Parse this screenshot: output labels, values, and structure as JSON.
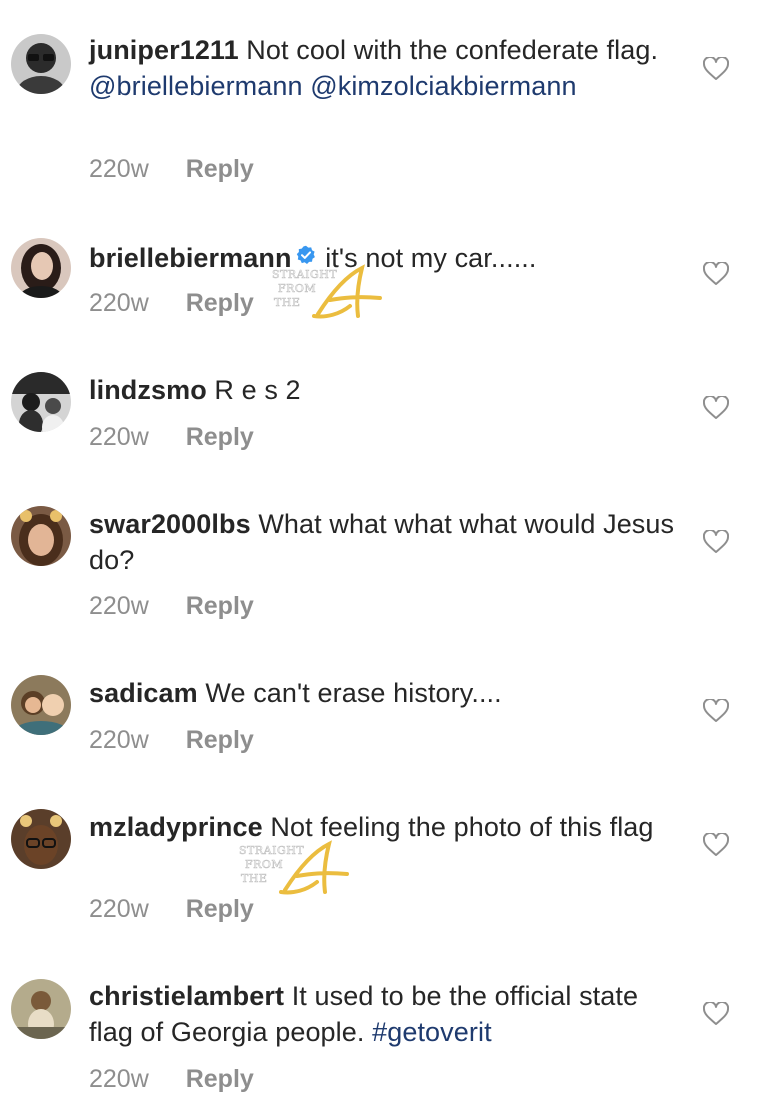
{
  "comments": [
    {
      "username": "juniper1211",
      "verified": false,
      "segments": [
        {
          "type": "text",
          "value": "Not cool with the confederate flag. "
        },
        {
          "type": "mention",
          "value": "@briellebiermann"
        },
        {
          "type": "text",
          "value": " "
        },
        {
          "type": "mention",
          "value": "@kimzolciakbiermann"
        }
      ],
      "time": "220w",
      "reply": "Reply",
      "avatar_colors": [
        "#2b2b2b",
        "#a9a9a9"
      ]
    },
    {
      "username": "briellebiermann",
      "verified": true,
      "segments": [
        {
          "type": "text",
          "value": "it's not my car......"
        }
      ],
      "time": "220w",
      "reply": "Reply",
      "avatar_colors": [
        "#3a2a28",
        "#d9c7bd"
      ]
    },
    {
      "username": "lindzsmo",
      "verified": false,
      "segments": [
        {
          "type": "text",
          "value": "R e s 2"
        }
      ],
      "time": "220w",
      "reply": "Reply",
      "avatar_colors": [
        "#222222",
        "#cfcfcf"
      ]
    },
    {
      "username": "swar2000lbs",
      "verified": false,
      "segments": [
        {
          "type": "text",
          "value": "What what what what would Jesus do?"
        }
      ],
      "time": "220w",
      "reply": "Reply",
      "avatar_colors": [
        "#5a3b26",
        "#d7a98a"
      ]
    },
    {
      "username": "sadicam",
      "verified": false,
      "segments": [
        {
          "type": "text",
          "value": "We can't erase history...."
        }
      ],
      "time": "220w",
      "reply": "Reply",
      "avatar_colors": [
        "#6a5a3d",
        "#e0bfa0"
      ]
    },
    {
      "username": "mzladyprince",
      "verified": false,
      "segments": [
        {
          "type": "text",
          "value": "Not feeling the photo of this flag"
        }
      ],
      "time": "220w",
      "reply": "Reply",
      "avatar_colors": [
        "#3b2a1e",
        "#e9c77a"
      ]
    },
    {
      "username": "christielambert",
      "verified": false,
      "segments": [
        {
          "type": "text",
          "value": "It used to be the official state flag of Georgia people. "
        },
        {
          "type": "hashtag",
          "value": "#getoverit"
        }
      ],
      "time": "220w",
      "reply": "Reply",
      "avatar_colors": [
        "#6b6550",
        "#d8cdb0"
      ]
    }
  ],
  "watermark": {
    "lines": [
      "STRAIGHT",
      "FROM",
      "THE"
    ],
    "logo_letter": "A",
    "color": "#e8b21e"
  },
  "colors": {
    "text": "#262626",
    "meta": "#8e8e8e",
    "link": "#1e3a6e",
    "verified": "#3897f0"
  }
}
